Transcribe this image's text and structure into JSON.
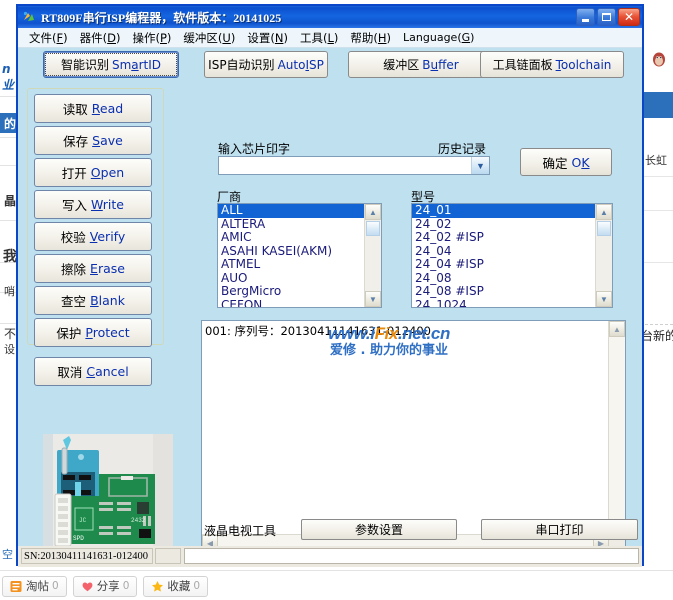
{
  "window": {
    "title": "RT809F串行ISP编程器，软件版本：20141025",
    "icon": "app-icon",
    "minimize_label": "",
    "maximize_label": "",
    "close_label": "✕"
  },
  "menubar": {
    "items": [
      {
        "cn": "文件",
        "key": "F"
      },
      {
        "cn": "器件",
        "key": "D"
      },
      {
        "cn": "操作",
        "key": "P"
      },
      {
        "cn": "缓冲区",
        "key": "U"
      },
      {
        "cn": "设置",
        "key": "N"
      },
      {
        "cn": "工具",
        "key": "L"
      },
      {
        "cn": "帮助",
        "key": "H"
      },
      {
        "cn": "Language",
        "key": "G"
      }
    ]
  },
  "toolbar": {
    "buttons": [
      {
        "cn": "智能识别",
        "en_pre": "Sm",
        "en_key": "a",
        "en_post": "rtID",
        "focused": true
      },
      {
        "cn": "ISP自动识别",
        "en_pre": "Auto",
        "en_key": "I",
        "en_post": "SP",
        "focused": false
      },
      {
        "cn": "缓冲区",
        "en_pre": "B",
        "en_key": "u",
        "en_post": "ffer",
        "focused": false
      },
      {
        "cn": "工具链面板",
        "en_pre": "",
        "en_key": "T",
        "en_post": "oolchain",
        "focused": false
      }
    ]
  },
  "sidebar": {
    "buttons": [
      {
        "cn": "读取",
        "en_pre": "",
        "en_key": "R",
        "en_post": "ead"
      },
      {
        "cn": "保存",
        "en_pre": "",
        "en_key": "S",
        "en_post": "ave"
      },
      {
        "cn": "打开",
        "en_pre": "",
        "en_key": "O",
        "en_post": "pen"
      },
      {
        "cn": "写入",
        "en_pre": "",
        "en_key": "W",
        "en_post": "rite"
      },
      {
        "cn": "校验",
        "en_pre": "",
        "en_key": "V",
        "en_post": "erify"
      },
      {
        "cn": "擦除",
        "en_pre": "",
        "en_key": "E",
        "en_post": "rase"
      },
      {
        "cn": "查空",
        "en_pre": "",
        "en_key": "B",
        "en_post": "lank"
      },
      {
        "cn": "保护",
        "en_pre": "",
        "en_key": "P",
        "en_post": "rotect"
      }
    ],
    "cancel": {
      "cn": "取消",
      "en_pre": "",
      "en_key": "C",
      "en_post": "ancel"
    },
    "device_photo_alt": "programmer-adapter-board-photo"
  },
  "chip_input": {
    "label": "输入芯片印字",
    "history_label": "历史记录",
    "value": "",
    "placeholder": "",
    "dropdown_icon": "chevron-down-icon",
    "ok_button": {
      "cn": "确定",
      "en_pre": "O",
      "en_key": "K",
      "en_post": ""
    }
  },
  "manufacturer_list": {
    "label": "厂商",
    "selected": "ALL",
    "items": [
      "ALL",
      "ALTERA",
      "AMIC",
      "ASAHI KASEI(AKM)",
      "ATMEL",
      "AUO",
      "BergMicro",
      "CEFON"
    ]
  },
  "model_list": {
    "label": "型号",
    "selected": "24_01",
    "items": [
      "24_01",
      "24_02",
      "24_02 #ISP",
      "24_04",
      "24_04 #ISP",
      "24_08",
      "24_08 #ISP",
      "24_1024"
    ]
  },
  "log": {
    "lines": [
      "001: 序列号：20130411141631-012400"
    ],
    "watermark_line1_a": "www.i",
    "watermark_line1_b": "Fix",
    "watermark_line1_c": ".net.cn",
    "watermark_line2": "爱修 . 助力你的事业"
  },
  "bottom_bar": {
    "label": "液晶电视工具",
    "buttons": [
      "参数设置",
      "串口打印"
    ]
  },
  "statusbar": {
    "serial": "SN:20130411141631-012400",
    "cell2": "",
    "cell3": ""
  },
  "share_bar": {
    "buttons": [
      {
        "label": "淘帖",
        "count": "0",
        "icon": "note-icon"
      },
      {
        "label": "分享",
        "count": "0",
        "icon": "heart-icon"
      },
      {
        "label": "收藏",
        "count": "0",
        "icon": "star-icon"
      }
    ]
  },
  "background_page": {
    "left_fragments": [
      "n",
      "业",
      "的",
      "晶",
      "我",
      "哨",
      "不",
      "设"
    ],
    "right_fragments": [
      "长虹",
      "台新的",
      "QQ"
    ],
    "right_qq_icon": "penguin-icon"
  },
  "colors": {
    "title_bar": "#0b50cf",
    "window_border": "#0a46c8",
    "client_bg": "#bfe0ef",
    "selection": "#1264d4",
    "accent_link": "#0a2fb0",
    "watermark": "#2f6fc4",
    "watermark_highlight": "#e8890c"
  }
}
